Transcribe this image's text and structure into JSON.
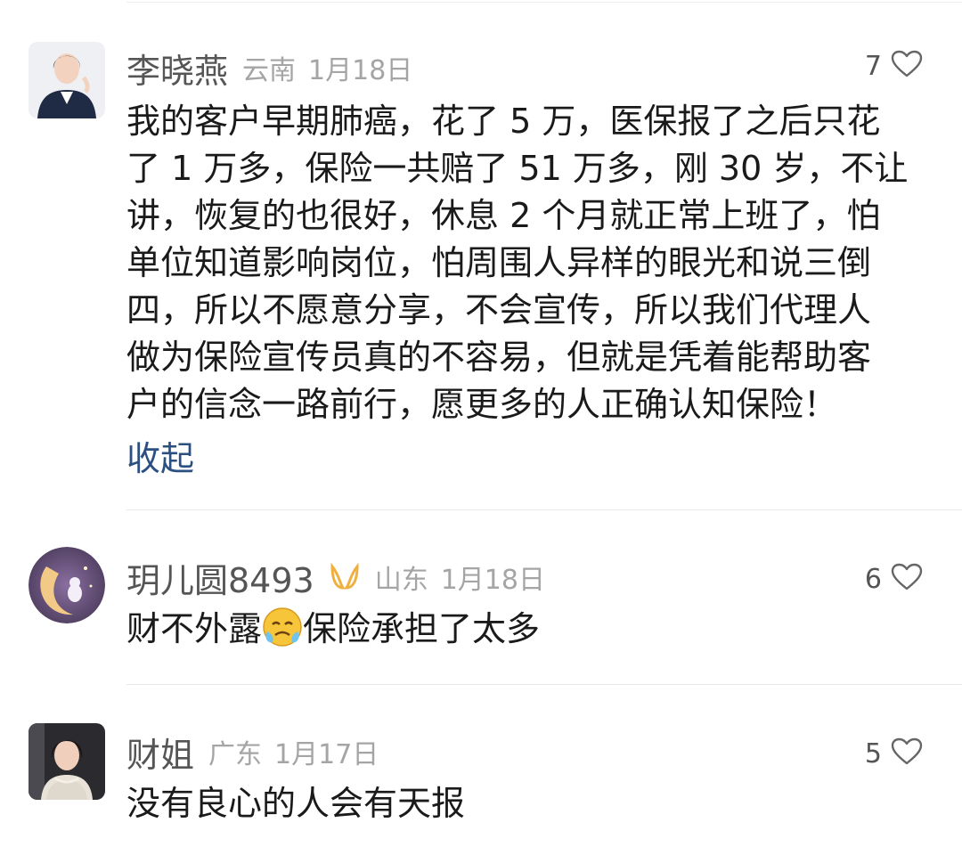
{
  "comments": [
    {
      "name": "李晓燕",
      "region": "云南",
      "date": "1月18日",
      "likes": "7",
      "text_lines": [
        "我的客户早期肺癌，花了 5 万，医保报了之后只花",
        "了 1 万多，保险一共赔了 51 万多，刚 30 岁，不让",
        "讲，恢复的也很好，休息 2 个月就正常上班了，怕",
        "单位知道影响岗位，怕周围人异样的眼光和说三倒",
        "四，所以不愿意分享，不会宣传，所以我们代理人",
        "做为保险宣传员真的不容易，但就是凭着能帮助客",
        "户的信念一路前行，愿更多的人正确认知保险！"
      ],
      "collapse_label": "收起"
    },
    {
      "name": "玥儿圆8493",
      "region": "山东",
      "date": "1月18日",
      "likes": "6",
      "text_before_emoji": "财不外露",
      "emoji_icon": "crying-face-emoji",
      "text_after_emoji": "保险承担了太多"
    },
    {
      "name": "财姐",
      "region": "广东",
      "date": "1月17日",
      "likes": "5",
      "text": "没有良心的人会有天报"
    }
  ],
  "colors": {
    "collapse_link": "#2c4f82",
    "badge": "#f0b040",
    "meta_gray": "#a5a5a5"
  }
}
